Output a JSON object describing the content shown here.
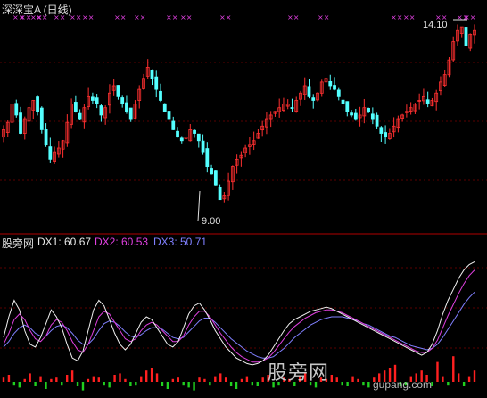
{
  "header": {
    "title": "深深宝A (日线)",
    "high_price": "14.10",
    "low_price": "9.00"
  },
  "indicator": {
    "name": "股旁网",
    "dx1": "DX1: 60.67",
    "dx2": "DX2: 60.53",
    "dx3": "DX3: 50.71"
  },
  "watermark": {
    "site": "股旁网",
    "url": "gupang.com"
  },
  "colors": {
    "background": "#000000",
    "up_candle": "#ff3030",
    "down_candle": "#54ffff",
    "divider": "#b00000",
    "signal_marker": "#e040e0",
    "dx1_line": "#f0f0f0",
    "dx2_line": "#e040e0",
    "dx3_line": "#8080ff",
    "hist_pos": "#ff2020",
    "hist_neg": "#20d020"
  },
  "chart_data": {
    "type": "candlestick+indicator",
    "price_axis": {
      "max": 14.1,
      "min": 9.0
    },
    "candles_close": [
      11.2,
      11.4,
      11.9,
      11.6,
      11.1,
      11.5,
      11.8,
      12.0,
      11.7,
      11.2,
      10.8,
      10.4,
      10.6,
      10.7,
      10.9,
      11.4,
      11.9,
      11.7,
      11.5,
      11.8,
      12.1,
      12.0,
      11.9,
      11.6,
      11.8,
      12.2,
      12.4,
      12.1,
      11.9,
      11.7,
      11.5,
      11.9,
      12.3,
      12.6,
      12.9,
      12.6,
      12.3,
      12.0,
      11.7,
      11.5,
      11.2,
      11.0,
      10.9,
      11.0,
      11.2,
      11.1,
      10.9,
      10.6,
      10.2,
      10.0,
      9.7,
      9.3,
      9.4,
      9.8,
      10.2,
      10.4,
      10.5,
      10.7,
      10.8,
      10.9,
      11.1,
      11.3,
      11.5,
      11.6,
      11.7,
      11.8,
      11.9,
      11.9,
      11.8,
      12.0,
      12.2,
      12.4,
      12.1,
      12.0,
      12.2,
      12.5,
      12.6,
      12.4,
      12.3,
      12.1,
      11.9,
      11.7,
      11.6,
      11.5,
      11.6,
      11.8,
      11.7,
      11.5,
      11.3,
      11.1,
      11.0,
      11.1,
      11.3,
      11.5,
      11.6,
      11.7,
      11.8,
      11.9,
      12.0,
      12.1,
      11.9,
      12.0,
      12.2,
      12.5,
      12.7,
      13.1,
      13.6,
      13.9,
      14.0,
      13.5,
      13.8,
      13.9
    ],
    "dx1": [
      35,
      50,
      62,
      55,
      40,
      30,
      28,
      35,
      45,
      55,
      50,
      42,
      30,
      20,
      18,
      25,
      40,
      55,
      62,
      58,
      48,
      38,
      30,
      26,
      30,
      38,
      46,
      50,
      48,
      42,
      36,
      30,
      28,
      32,
      42,
      52,
      58,
      60,
      55,
      48,
      40,
      34,
      28,
      24,
      20,
      18,
      16,
      15,
      16,
      18,
      22,
      28,
      34,
      40,
      45,
      48,
      50,
      52,
      54,
      55,
      56,
      57,
      56,
      54,
      52,
      50,
      48,
      46,
      44,
      42,
      40,
      38,
      36,
      34,
      32,
      30,
      28,
      26,
      24,
      22,
      24,
      30,
      40,
      52,
      62,
      70,
      78,
      84,
      88,
      90
    ],
    "dx2": [
      30,
      38,
      48,
      52,
      48,
      40,
      34,
      32,
      36,
      44,
      48,
      46,
      40,
      32,
      26,
      24,
      30,
      40,
      50,
      54,
      52,
      46,
      40,
      34,
      32,
      34,
      40,
      44,
      46,
      44,
      40,
      36,
      32,
      32,
      36,
      44,
      50,
      54,
      54,
      50,
      44,
      38,
      33,
      28,
      24,
      21,
      19,
      17,
      17,
      18,
      20,
      24,
      29,
      34,
      39,
      43,
      46,
      49,
      51,
      53,
      54,
      55,
      55,
      54,
      53,
      51,
      49,
      47,
      45,
      43,
      41,
      39,
      37,
      35,
      33,
      31,
      29,
      27,
      25,
      24,
      24,
      27,
      33,
      42,
      51,
      59,
      67,
      74,
      80,
      84
    ],
    "dx3": [
      28,
      32,
      38,
      42,
      44,
      42,
      38,
      36,
      36,
      40,
      43,
      44,
      42,
      38,
      33,
      30,
      30,
      34,
      40,
      45,
      47,
      46,
      43,
      39,
      36,
      35,
      37,
      40,
      42,
      42,
      41,
      38,
      35,
      34,
      35,
      39,
      43,
      47,
      49,
      49,
      46,
      42,
      38,
      34,
      31,
      28,
      25,
      23,
      21,
      20,
      20,
      21,
      24,
      27,
      31,
      35,
      38,
      41,
      44,
      46,
      48,
      49,
      50,
      50,
      50,
      49,
      48,
      47,
      45,
      44,
      42,
      40,
      38,
      36,
      35,
      33,
      31,
      29,
      28,
      27,
      26,
      27,
      30,
      35,
      41,
      47,
      53,
      59,
      64,
      68
    ],
    "histogram": [
      3,
      5,
      -2,
      -4,
      2,
      6,
      -3,
      4,
      -5,
      2,
      3,
      -2,
      5,
      8,
      -3,
      -6,
      2,
      4,
      3,
      -2,
      -4,
      5,
      6,
      2,
      -3,
      -2,
      4,
      8,
      10,
      6,
      -3,
      -5,
      2,
      3,
      -2,
      -4,
      -6,
      3,
      2,
      -2,
      4,
      6,
      3,
      -3,
      -5,
      2,
      4,
      -2,
      -3,
      3,
      5,
      -4,
      -2,
      3,
      2,
      -3,
      4,
      6,
      -2,
      -4,
      3,
      2,
      5,
      3,
      -2,
      -3,
      4,
      2,
      -2,
      -4,
      3,
      6,
      8,
      10,
      12,
      -3,
      -2,
      4,
      6,
      8,
      5,
      -3,
      14,
      4,
      -2,
      18,
      6,
      -3,
      4,
      8
    ]
  }
}
